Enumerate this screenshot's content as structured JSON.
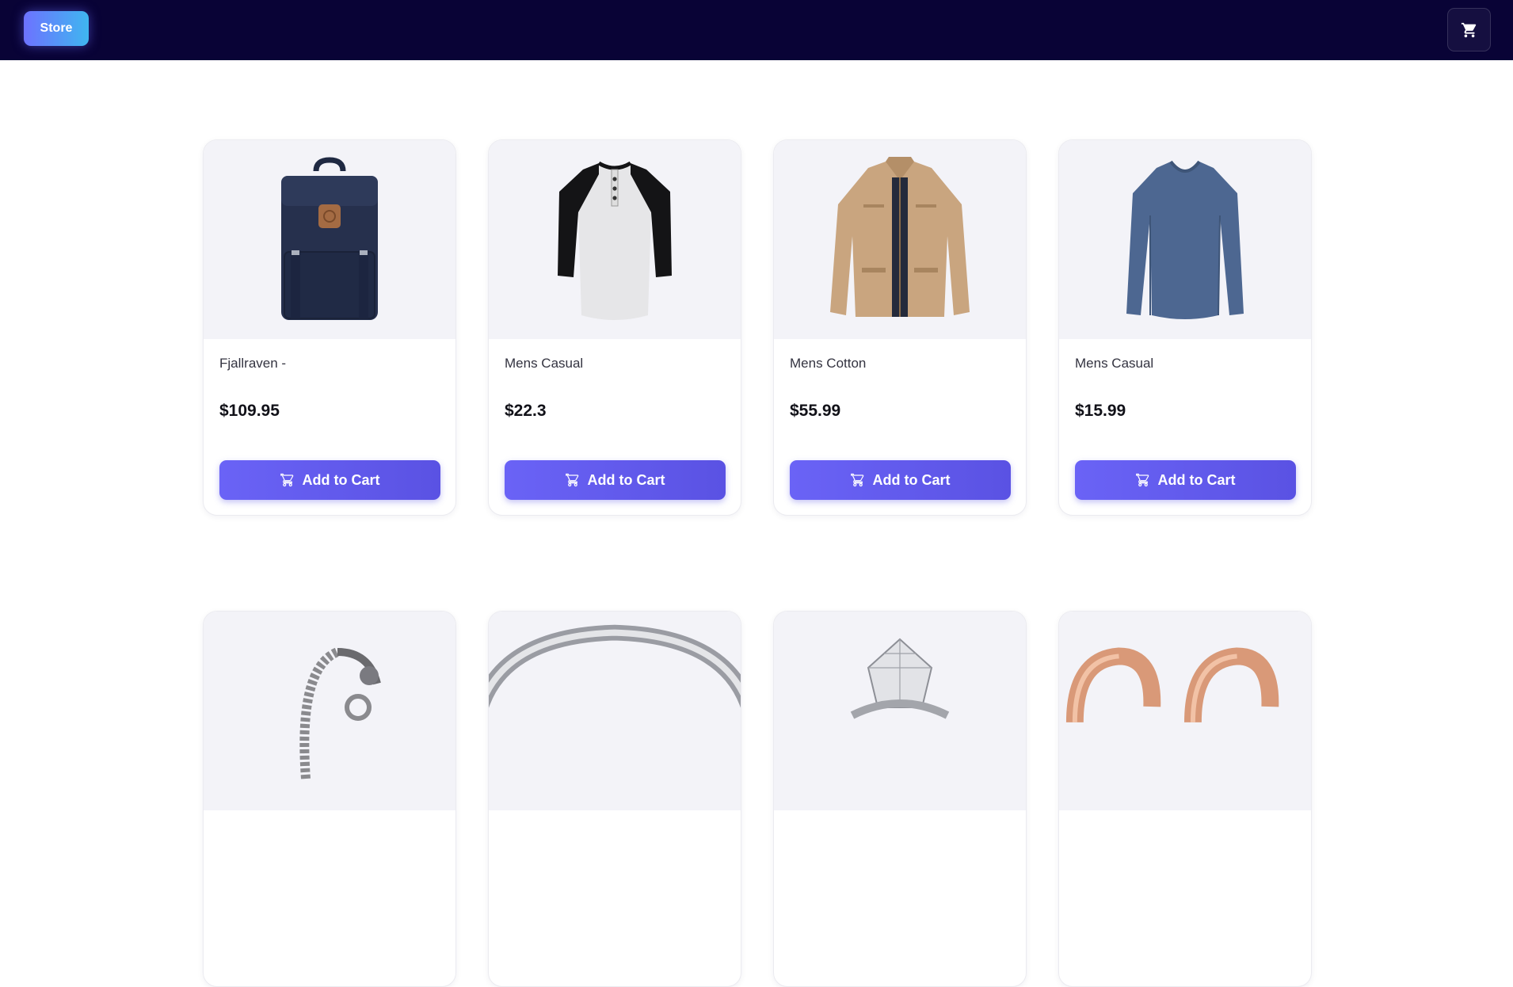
{
  "navbar": {
    "brand_label": "Store",
    "cart_icon": "cart-icon"
  },
  "colors": {
    "navbar_bg": "#090336",
    "accent": "#6366f1",
    "card_image_bg": "#f3f3f8"
  },
  "products": [
    {
      "title": "Fjallraven -",
      "price": "$109.95",
      "button_label": "Add to Cart",
      "image_icon": "backpack-image"
    },
    {
      "title": "Mens Casual",
      "price": "$22.3",
      "button_label": "Add to Cart",
      "image_icon": "raglan-tshirt-image"
    },
    {
      "title": "Mens Cotton",
      "price": "$55.99",
      "button_label": "Add to Cart",
      "image_icon": "jacket-image"
    },
    {
      "title": "Mens Casual",
      "price": "$15.99",
      "button_label": "Add to Cart",
      "image_icon": "long-sleeve-shirt-image"
    },
    {
      "image_icon": "chain-bracelet-image"
    },
    {
      "image_icon": "ring-band-image"
    },
    {
      "image_icon": "diamond-ring-image"
    },
    {
      "image_icon": "rose-gold-rings-image"
    }
  ]
}
